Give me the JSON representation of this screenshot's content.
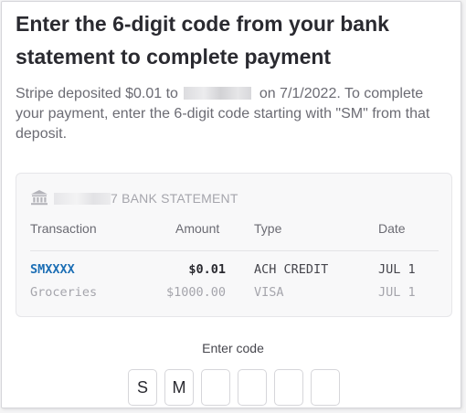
{
  "title": "Enter the 6-digit code from your bank statement to complete payment",
  "description": {
    "part1": "Stripe deposited $0.01 to",
    "part2": "on  7/1/2022. To complete your payment, enter the 6-digit code starting with \"SM\" from that deposit."
  },
  "statement": {
    "header_suffix": "7 BANK STATEMENT",
    "icon": "bank-icon",
    "columns": [
      "Transaction",
      "Amount",
      "Type",
      "Date"
    ],
    "rows": [
      {
        "transaction": "SMXXXX",
        "amount": "$0.01",
        "type": "ACH CREDIT",
        "date": "JUL 1"
      },
      {
        "transaction": "Groceries",
        "amount": "$1000.00",
        "type": "VISA",
        "date": "JUL 1"
      }
    ]
  },
  "code": {
    "label": "Enter code",
    "digits": [
      "S",
      "M",
      "",
      "",
      "",
      ""
    ]
  },
  "colors": {
    "link": "#1d6fb5",
    "text": "#2a2a30",
    "muted": "#6b6b73",
    "border": "#d6d6da"
  }
}
